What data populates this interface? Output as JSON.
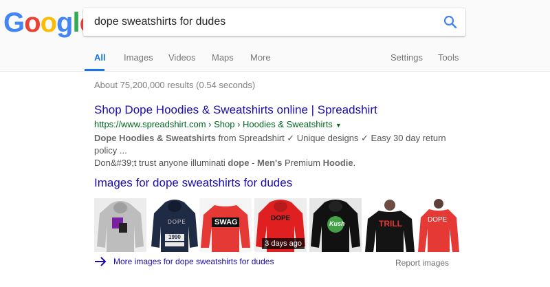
{
  "logo": {
    "letters": [
      "G",
      "o",
      "o",
      "g",
      "l",
      "e"
    ],
    "colors": [
      "#4285f4",
      "#ea4335",
      "#fbbc05",
      "#4285f4",
      "#34a853",
      "#ea4335"
    ]
  },
  "search": {
    "query": "dope sweatshirts for dudes",
    "button_icon": "search-icon"
  },
  "tabs": {
    "all": "All",
    "images": "Images",
    "videos": "Videos",
    "maps": "Maps",
    "more": "More",
    "settings": "Settings",
    "tools": "Tools"
  },
  "stats": "About 75,200,000 results (0.54 seconds)",
  "result": {
    "title": "Shop Dope Hoodies & Sweatshirts online | Spreadshirt",
    "url": "https://www.spreadshirt.com › Shop › Hoodies & Sweatshirts",
    "snippet": {
      "b1": "Dope Hoodies & Sweatshirts",
      "t1": " from Spreadshirt ✓ Unique designs ✓ Easy 30 day return policy ...",
      "t2": "Don&#39;t trust anyone illuminati ",
      "b2": "dope",
      "t3": " - ",
      "b3": "Men's",
      "t4": " Premium ",
      "b4": "Hoodie",
      "t5": "."
    }
  },
  "images_section": {
    "heading": "Images for dope sweatshirts for dudes",
    "thumbnails": [
      {
        "name": "thumb-grey-hoodie"
      },
      {
        "name": "thumb-navy-hoodie",
        "print": "DOPE",
        "print2": "1990"
      },
      {
        "name": "thumb-red-sweatshirt",
        "print": "SWAG"
      },
      {
        "name": "thumb-red-hoodie",
        "print": "DOPE",
        "badge": "3 days ago"
      },
      {
        "name": "thumb-black-hoodie",
        "print": "Kush"
      },
      {
        "name": "thumb-black-sweatshirt",
        "print": "TRILL"
      },
      {
        "name": "thumb-red-longsleeve",
        "print": "DOPE"
      }
    ],
    "more_link": "More images for dope sweatshirts for dudes",
    "report_link": "Report images"
  },
  "colors": {
    "link": "#1a0dab",
    "url": "#006621",
    "accent": "#1a73e8"
  }
}
